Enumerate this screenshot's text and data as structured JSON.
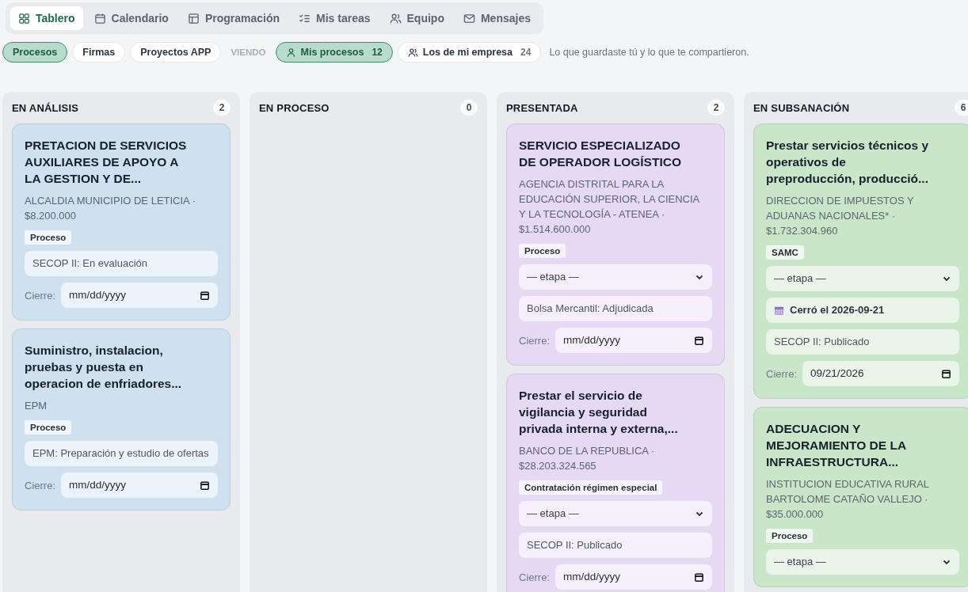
{
  "tabs": [
    {
      "label": "Tablero",
      "selected": true
    },
    {
      "label": "Calendario",
      "selected": false
    },
    {
      "label": "Programación",
      "selected": false
    },
    {
      "label": "Mis tareas",
      "selected": false
    },
    {
      "label": "Equipo",
      "selected": false
    },
    {
      "label": "Mensajes",
      "selected": false
    }
  ],
  "filters": [
    {
      "label": "Procesos",
      "selected": true
    },
    {
      "label": "Firmas",
      "selected": false
    },
    {
      "label": "Proyectos APP",
      "selected": false
    }
  ],
  "viewing_label": "VIENDO",
  "scopes": [
    {
      "label": "Mis procesos",
      "count": "12",
      "selected": true
    },
    {
      "label": "Los de mi empresa",
      "count": "24",
      "selected": false
    }
  ],
  "scope_hint": "Lo que guardaste tú y lo que te compartieron.",
  "columns": [
    {
      "title": "EN ANÁLISIS",
      "count": "2",
      "cards": [
        {
          "color": "#cfe0ef",
          "title": "PRETACION DE SERVICIOS AUXILIARES DE APOYO A LA GESTION Y DE...",
          "meta": "ALCALDIA MUNICIPIO DE LETICIA · $8.200.000",
          "tag": "Proceso",
          "status": "SECOP II: En evaluación",
          "close_label": "Cierre:",
          "date": {
            "placeholder": "mm/dd/yyyy"
          }
        },
        {
          "color": "#cfe0ef",
          "title": "Suministro, instalacion, pruebas y puesta en operacion de enfriadores...",
          "meta": "EPM",
          "tag": "Proceso",
          "status": "EPM: Preparación y estudio de ofertas",
          "close_label": "Cierre:",
          "date": {
            "placeholder": "mm/dd/yyyy"
          }
        }
      ]
    },
    {
      "title": "EN PROCESO",
      "count": "0"
    },
    {
      "title": "PRESENTADA",
      "count": "2",
      "cards": [
        {
          "color": "#e6d9f4",
          "title": "SERVICIO ESPECIALIZADO DE OPERADOR LOGÍSTICO",
          "meta": "AGENCIA DISTRITAL PARA LA EDUCACIÓN SUPERIOR, LA CIENCIA Y LA TECNOLOGÍA - ATENEA · $1.514.600.000",
          "tag": "Proceso",
          "stage": "— etapa —",
          "status": "Bolsa Mercantil: Adjudicada",
          "close_label": "Cierre:",
          "date": {
            "placeholder": "mm/dd/yyyy"
          }
        },
        {
          "color": "#e6d9f4",
          "title": "Prestar el servicio de vigilancia y seguridad privada interna y externa,...",
          "meta": "BANCO DE LA REPUBLICA · $28.203.324.565",
          "tag": "Contratación régimen especial",
          "stage": "— etapa —",
          "status": "SECOP II: Publicado",
          "close_label": "Cierre:",
          "date": {
            "placeholder": "mm/dd/yyyy"
          }
        }
      ]
    },
    {
      "title": "EN SUBSANACIÓN",
      "count": "6",
      "cards": [
        {
          "color": "#cae6c9",
          "title": "Prestar servicios técnicos y operativos de preproducción, producció...",
          "meta": "DIRECCION DE IMPUESTOS Y ADUANAS NACIONALES* · $1.732.304.960",
          "tag": "SAMC",
          "stage": "— etapa —",
          "closed": "Cerró el 2026-09-21",
          "status": "SECOP II: Publicado",
          "close_label": "Cierre:",
          "date": {
            "value": "09/21/2026"
          }
        },
        {
          "color": "#cae6c9",
          "title": "ADECUACION Y MEJORAMIENTO DE LA INFRAESTRUCTURA...",
          "meta": "INSTITUCION EDUCATIVA RURAL BARTOLOME CATAÑO VALLEJO · $35.000.000",
          "tag": "Proceso",
          "stage": "— etapa —"
        }
      ]
    }
  ]
}
